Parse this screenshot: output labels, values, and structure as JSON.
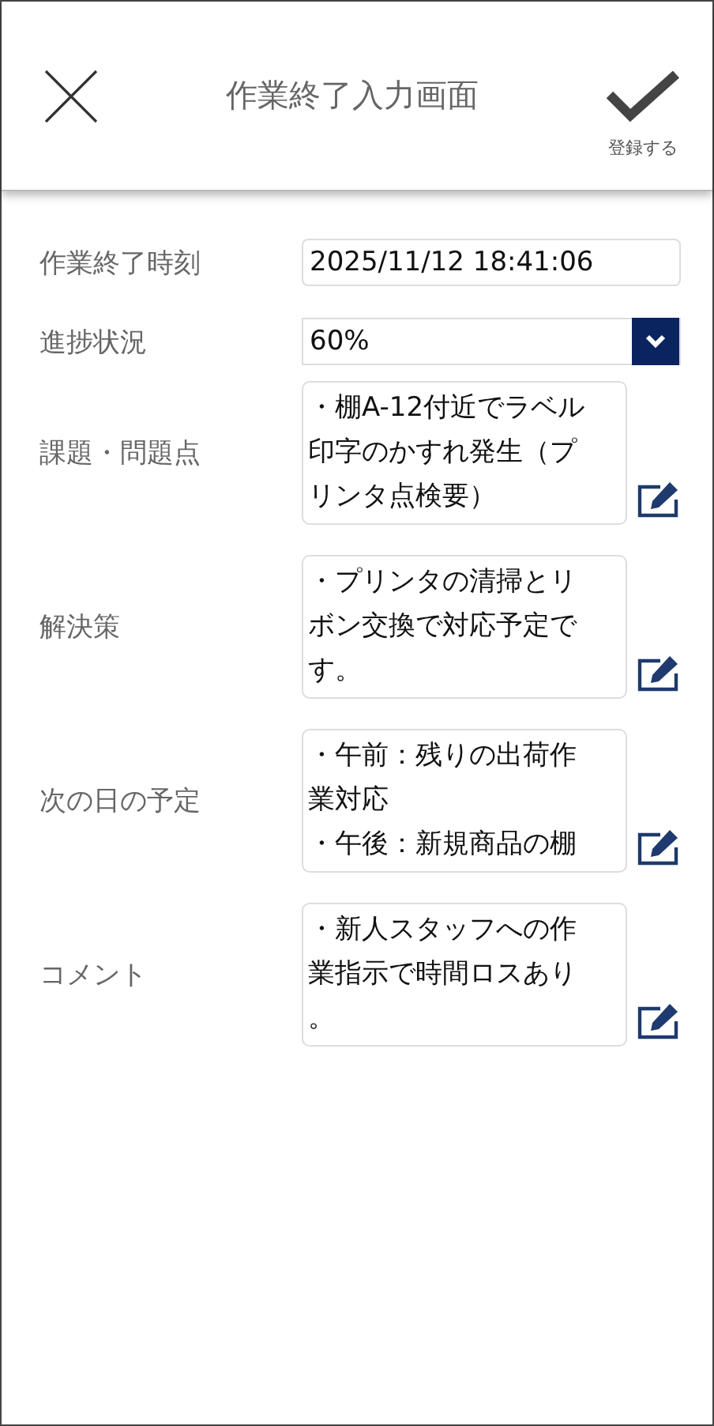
{
  "header": {
    "title": "作業終了入力画面",
    "register_label": "登録する"
  },
  "fields": [
    {
      "kind": "text",
      "label": "作業終了時刻",
      "value": "2025/11/12 18:41:06"
    },
    {
      "kind": "select",
      "label": "進捗状況",
      "value": "60%"
    },
    {
      "kind": "memo",
      "label": "課題・問題点",
      "lines": [
        "・棚A-12付近でラベル",
        "印字のかすれ発生（プ",
        "リンタ点検要）"
      ]
    },
    {
      "kind": "memo",
      "label": "解決策",
      "lines": [
        "・プリンタの清掃とリ",
        "ボン交換で対応予定で",
        "す。"
      ]
    },
    {
      "kind": "memo",
      "label": "次の日の予定",
      "lines": [
        "・午前：残りの出荷作",
        "業対応",
        "・午後：新規商品の棚"
      ]
    },
    {
      "kind": "memo",
      "label": "コメント",
      "lines": [
        "・新人スタッフへの作",
        "業指示で時間ロスあり",
        "。"
      ]
    }
  ]
}
